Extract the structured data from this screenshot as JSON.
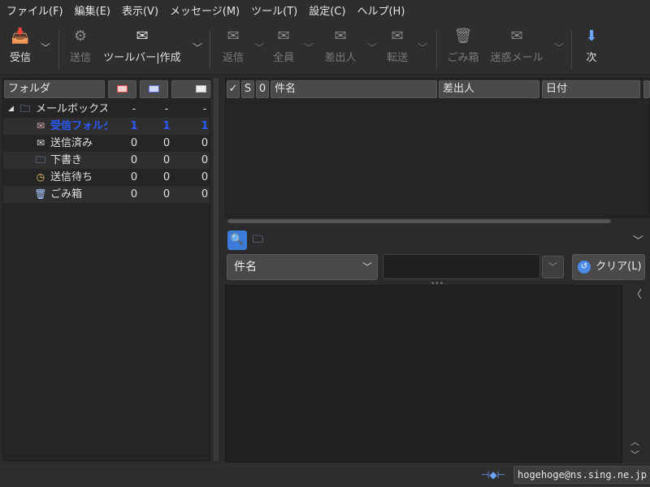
{
  "menu": [
    "ファイル(F)",
    "編集(E)",
    "表示(V)",
    "メッセージ(M)",
    "ツール(T)",
    "設定(C)",
    "ヘルプ(H)"
  ],
  "toolbar": {
    "receive": "受信",
    "send": "送信",
    "compose": "ツールバー|作成",
    "reply": "返信",
    "reply_all": "全員",
    "reply_sender": "差出人",
    "forward": "転送",
    "trash": "ごみ箱",
    "spam": "迷惑メール",
    "next": "次"
  },
  "folder_header": {
    "label": "フォルダ"
  },
  "folders": [
    {
      "name": "メールボックス",
      "c1": "-",
      "c2": "-",
      "c3": "-",
      "icon": "mailbox-icon"
    },
    {
      "name": "受信フォルダ",
      "c1": "1",
      "c2": "1",
      "c3": "1",
      "icon": "inbox-icon"
    },
    {
      "name": "送信済み",
      "c1": "0",
      "c2": "0",
      "c3": "0",
      "icon": "sent-icon"
    },
    {
      "name": "下書き",
      "c1": "0",
      "c2": "0",
      "c3": "0",
      "icon": "draft-icon"
    },
    {
      "name": "送信待ち",
      "c1": "0",
      "c2": "0",
      "c3": "0",
      "icon": "queue-icon"
    },
    {
      "name": "ごみ箱",
      "c1": "0",
      "c2": "0",
      "c3": "0",
      "icon": "trash-icon"
    }
  ],
  "msg_headers": {
    "check": "✓",
    "s": "S",
    "clip": "0",
    "subject": "件名",
    "sender": "差出人",
    "date": "日付"
  },
  "quicksearch": {
    "field": "件名",
    "clear": "クリア(L)"
  },
  "status": {
    "account": "hogehoge@ns.sing.ne.jp"
  },
  "colors": {
    "accent": "#3d7bd9",
    "unread": "#2a5bff",
    "bg": "#2b2b2b"
  }
}
